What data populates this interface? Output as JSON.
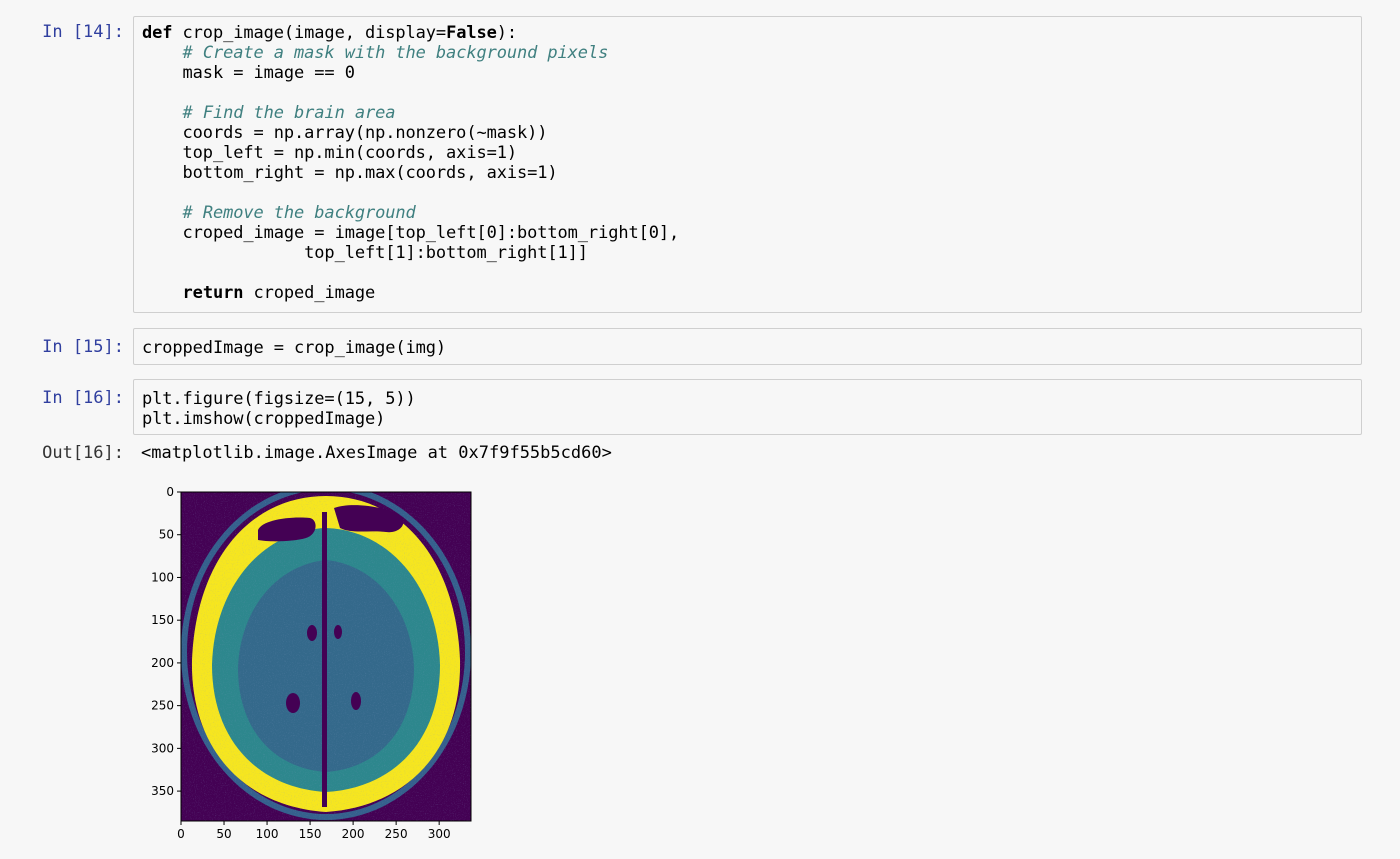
{
  "cells": [
    {
      "prompt": "In [14]:",
      "lines": [
        [
          {
            "t": "k",
            "v": "def"
          },
          {
            "t": "n",
            "v": " crop_image(image, display="
          },
          {
            "t": "k",
            "v": "False"
          },
          {
            "t": "n",
            "v": "):"
          }
        ],
        [
          {
            "t": "n",
            "v": "    "
          },
          {
            "t": "c",
            "v": "# Create a mask with the background pixels"
          }
        ],
        [
          {
            "t": "n",
            "v": "    mask = image == 0"
          }
        ],
        [
          {
            "t": "n",
            "v": ""
          }
        ],
        [
          {
            "t": "n",
            "v": "    "
          },
          {
            "t": "c",
            "v": "# Find the brain area"
          }
        ],
        [
          {
            "t": "n",
            "v": "    coords = np.array(np.nonzero(~mask))"
          }
        ],
        [
          {
            "t": "n",
            "v": "    top_left = np.min(coords, axis=1)"
          }
        ],
        [
          {
            "t": "n",
            "v": "    bottom_right = np.max(coords, axis=1)"
          }
        ],
        [
          {
            "t": "n",
            "v": ""
          }
        ],
        [
          {
            "t": "n",
            "v": "    "
          },
          {
            "t": "c",
            "v": "# Remove the background"
          }
        ],
        [
          {
            "t": "n",
            "v": "    croped_image = image[top_left[0]:bottom_right[0],"
          }
        ],
        [
          {
            "t": "n",
            "v": "                top_left[1]:bottom_right[1]]"
          }
        ],
        [
          {
            "t": "n",
            "v": ""
          }
        ],
        [
          {
            "t": "n",
            "v": "    "
          },
          {
            "t": "k",
            "v": "return"
          },
          {
            "t": "n",
            "v": " croped_image"
          }
        ]
      ]
    },
    {
      "prompt": "In [15]:",
      "lines": [
        [
          {
            "t": "n",
            "v": "croppedImage = crop_image(img)"
          }
        ]
      ]
    },
    {
      "prompt": "In [16]:",
      "lines": [
        [
          {
            "t": "n",
            "v": "plt.figure(figsize=(15, 5))"
          }
        ],
        [
          {
            "t": "n",
            "v": "plt.imshow(croppedImage)"
          }
        ]
      ]
    }
  ],
  "output": {
    "prompt": "Out[16]:",
    "text": "<matplotlib.image.AxesImage at 0x7f9f55b5cd60>"
  },
  "plot": {
    "x_ticks": [
      "0",
      "50",
      "100",
      "150",
      "200",
      "250",
      "300"
    ],
    "y_ticks": [
      "0",
      "50",
      "100",
      "150",
      "200",
      "250",
      "300",
      "350"
    ],
    "x_range": [
      0,
      337
    ],
    "y_range": [
      0,
      385
    ],
    "colors": {
      "background": "#440154",
      "skull": "#f6e61f",
      "brain": "#2d878d",
      "brain_dark": "#3b518b",
      "ring": "#35608d"
    }
  }
}
